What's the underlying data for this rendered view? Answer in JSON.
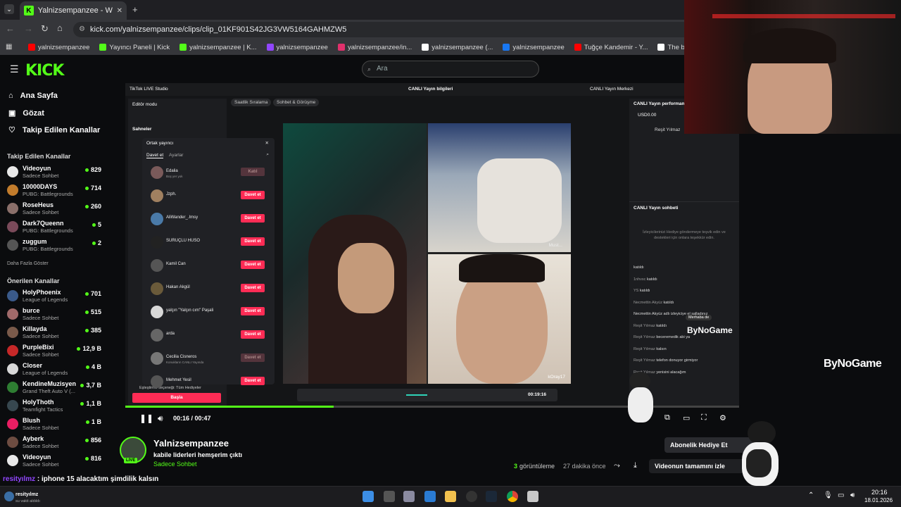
{
  "browser": {
    "tab_title": "Yalnizsempanzee - Watch cl",
    "url": "kick.com/yalnizsempanzee/clips/clip_01KF901S42JG3VW5164GAHMZW5",
    "bookmarks": [
      "yalnizsempanzee",
      "Yayıncı Paneli | Kick",
      "yalnizsempanzee | K...",
      "yalnizsempanzee",
      "yalnizsempanzee/in...",
      "yalnizsempanzee (...",
      "yalnizsempanzee",
      "Tuğçe Kandemir - Y...",
      "The best ChatBot an...",
      "DeepL Translate"
    ],
    "bookmark_colors": [
      "#ff0000",
      "#53fc18",
      "#53fc18",
      "#9146ff",
      "#e1306c",
      "#ffffff",
      "#1877f2",
      "#ff0000",
      "#ffffff",
      "#0f2b46"
    ]
  },
  "header": {
    "logo": "KICK",
    "search_placeholder": "Ara"
  },
  "sidebar": {
    "nav": [
      "Ana Sayfa",
      "Gözat",
      "Takip Edilen Kanallar"
    ],
    "followed_title": "Takip Edilen Kanallar",
    "followed": [
      {
        "name": "Videoyun",
        "game": "Sadece Sohbet",
        "count": "829",
        "color": "#e8e8e8"
      },
      {
        "name": "10000DAYS",
        "game": "PUBG: Battlegrounds",
        "count": "714",
        "color": "#c27c2c"
      },
      {
        "name": "RoseHeus",
        "game": "Sadece Sohbet",
        "count": "260",
        "color": "#8a6f6a"
      },
      {
        "name": "Dark7Queenn",
        "game": "PUBG: Battlegrounds",
        "count": "5",
        "color": "#7a4a5a"
      },
      {
        "name": "zuggum",
        "game": "PUBG: Battlegrounds",
        "count": "2",
        "color": "#555"
      }
    ],
    "show_more": "Daha Fazla Göster",
    "recommended_title": "Önerilen Kanallar",
    "recommended": [
      {
        "name": "HolyPhoenix",
        "game": "League of Legends",
        "count": "701",
        "color": "#3a5a8a"
      },
      {
        "name": "burce",
        "game": "Sadece Sohbet",
        "count": "515",
        "color": "#a06a6a"
      },
      {
        "name": "Killayda",
        "game": "Sadece Sohbet",
        "count": "385",
        "color": "#7a5a4a"
      },
      {
        "name": "PurpleBixi",
        "game": "Sadece Sohbet",
        "count": "12,9 B",
        "color": "#c62828"
      },
      {
        "name": "Closer",
        "game": "League of Legends",
        "count": "4 B",
        "color": "#d8d8d8"
      },
      {
        "name": "KendineMuzisyen",
        "game": "Grand Theft Auto V (...",
        "count": "3,7 B",
        "color": "#2e7d32"
      },
      {
        "name": "HolyThoth",
        "game": "Teamfight Tactics",
        "count": "1,1 B",
        "color": "#37474f"
      },
      {
        "name": "Blush",
        "game": "Sadece Sohbet",
        "count": "1 B",
        "color": "#e91e63"
      },
      {
        "name": "Ayberk",
        "game": "Sadece Sohbet",
        "count": "856",
        "color": "#6d4c41"
      },
      {
        "name": "Videoyun",
        "game": "Sadece Sohbet",
        "count": "816",
        "color": "#e8e8e8"
      }
    ]
  },
  "studio": {
    "app": "TikTok LIVE Studio",
    "center_title": "CANLI Yayın bilgileri",
    "right_link": "CANLI Yayın Merkezi",
    "pills": [
      "Saatlik Sıralama",
      "Sohbet & Görüşme"
    ],
    "editor_mode": "Editör modu",
    "scenes": "Sahneler",
    "popup_title": "Ortak yayıncı",
    "popup_tabs": [
      "Davet et",
      "Ayarlar"
    ],
    "invitees": [
      {
        "name": "Edalia",
        "sub": "Boş yer yok",
        "btn": "Katıl",
        "disabled": true,
        "color": "#7a5a5a"
      },
      {
        "name": "Jzph.",
        "sub": "",
        "btn": "Davet et",
        "disabled": false,
        "color": "#a08060"
      },
      {
        "name": "AliWander_.Imsy",
        "sub": "",
        "btn": "Davet et",
        "disabled": false,
        "color": "#4a7aa8"
      },
      {
        "name": "SURUÇLU HUSO",
        "sub": "",
        "btn": "Davet et",
        "disabled": false,
        "color": "#222"
      },
      {
        "name": "Kamil Can",
        "sub": "",
        "btn": "Davet et",
        "disabled": false,
        "color": "#555"
      },
      {
        "name": "Hakan Akgül",
        "sub": "",
        "btn": "Davet et",
        "disabled": false,
        "color": "#6a5a3a"
      },
      {
        "name": "yalçın \"Yalçın cım\" Paşali",
        "sub": "",
        "btn": "Davet et",
        "disabled": false,
        "color": "#d8d8d8"
      },
      {
        "name": "arda",
        "sub": "",
        "btn": "Davet et",
        "disabled": false,
        "color": "#666"
      },
      {
        "name": "Cecilia Cisneros",
        "sub": "Konukların CANLI Yayında",
        "btn": "Davet et",
        "disabled": true,
        "color": "#777"
      },
      {
        "name": "Mehmet Yesil",
        "sub": "",
        "btn": "Davet et",
        "disabled": false,
        "color": "#555"
      }
    ],
    "pairing": "Eşleştirme seçeneği: Tüm Hediyeler",
    "start_button": "Başla",
    "right_title": "CANLI Yayın performansı",
    "usd": "USD0.00",
    "viewer": "Reşit Yılmaz",
    "chat_title": "CANLI Yayın sohbeti",
    "chat_hint": "İzleyicilerinizi Hediye göndermeye teşvik edin ve destekleri için onlara teşekkür edin.",
    "chat": [
      {
        "u": "",
        "t": "katıldı"
      },
      {
        "u": "1nhvsc",
        "t": "katıldı"
      },
      {
        "u": "YS",
        "t": "katıldı"
      },
      {
        "u": "Necmettin Akyüz",
        "t": "katıldı"
      },
      {
        "u": "",
        "t": "Necmettin Akyüz adlı izleyiciye el salladınız"
      },
      {
        "u": "Reşit Yılmaz",
        "t": "katıldı"
      },
      {
        "u": "Reşit Yılmaz",
        "t": "beceremedik abi ya"
      },
      {
        "u": "Reşit Yılmaz",
        "t": "kalsın"
      },
      {
        "u": "Reşit Yılmaz",
        "t": "telefon donuyor girmiyor"
      },
      {
        "u": "Reşit Yılmaz",
        "t": "yenisini alacağım"
      }
    ],
    "merhaba": "Merhaba de",
    "tile_labels": [
      "Must...",
      "kOray17"
    ],
    "timer": "00:19:16"
  },
  "player": {
    "time": "00:16 / 00:47",
    "progress": 0.34
  },
  "watermark": "ByNoGame",
  "stream": {
    "channel": "Yalnizsempanzee",
    "title": "kabile liderleri hemşerim çıktı",
    "category": "Sadece Sohbet",
    "live": "LIVE",
    "views_count": "3",
    "views_label": "görüntüleme",
    "ago": "27 dakika önce",
    "full_video": "Videonun tamamını izle",
    "sub_gift": "Abonelik Hediye Et"
  },
  "overlay_chat": {
    "user": "resityılmz",
    "msg": "iphone 15 alacaktım şimdilik kalsın"
  },
  "taskbar": {
    "user": "resityılmz",
    "user_sub": "su vakti aldıldı",
    "time": "20:16",
    "date": "18.01.2026"
  }
}
